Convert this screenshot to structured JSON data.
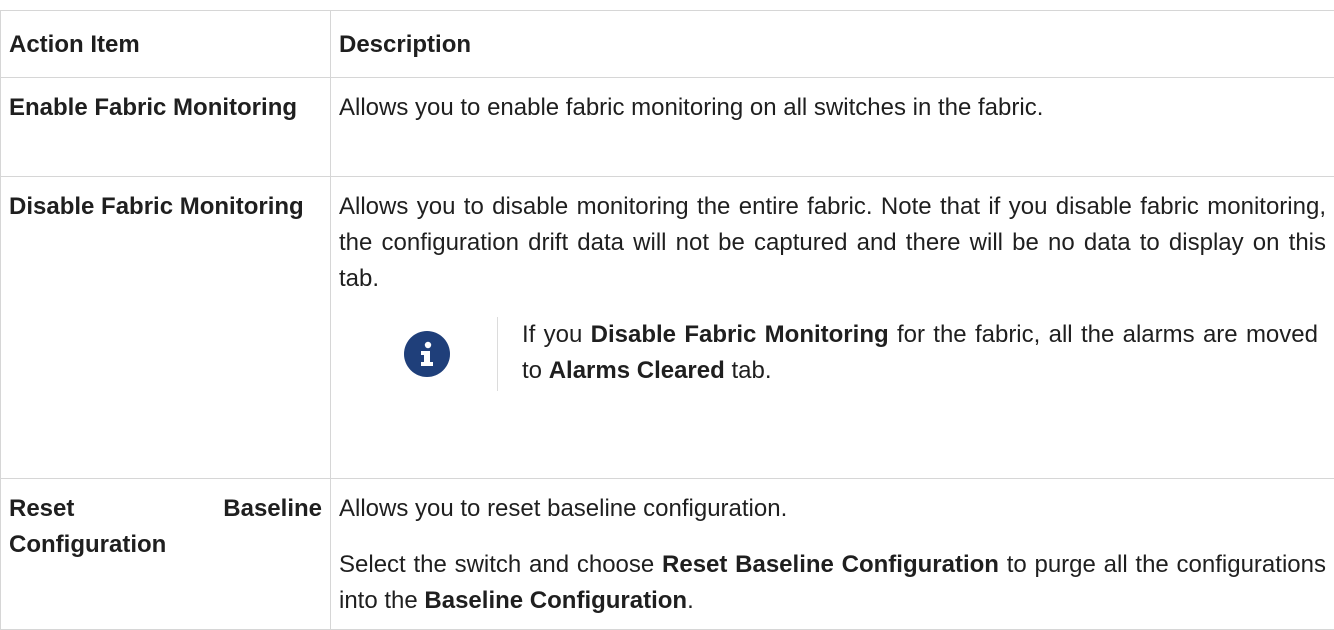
{
  "table": {
    "headers": {
      "action": "Action Item",
      "description": "Description"
    },
    "rows": [
      {
        "action": "Enable Fabric Monitoring",
        "description": "Allows you to enable fabric monitoring on all switches in the fabric."
      },
      {
        "action": "Disable Fabric Monitoring",
        "description": "Allows you to disable monitoring the entire fabric. Note that if you disable fabric monitoring, the configuration drift data will not be captured and there will be no data to display on this tab.",
        "note": {
          "icon": "info-icon",
          "pre": "If you ",
          "bold1": "Disable Fabric Monitoring",
          "mid": " for the fabric, all the alarms are moved to ",
          "bold2": "Alarms Cleared",
          "post": " tab."
        }
      },
      {
        "action": "Reset Baseline Configuration",
        "description": "Allows you to reset baseline configuration.",
        "detail": {
          "pre": "Select the switch and choose ",
          "bold1": "Reset Baseline Configuration",
          "mid": " to purge all the configurations into the ",
          "bold2": "Baseline Configuration",
          "post": "."
        }
      }
    ]
  },
  "colors": {
    "info_icon_bg": "#1f3f7a",
    "border": "#d6d6d6"
  }
}
